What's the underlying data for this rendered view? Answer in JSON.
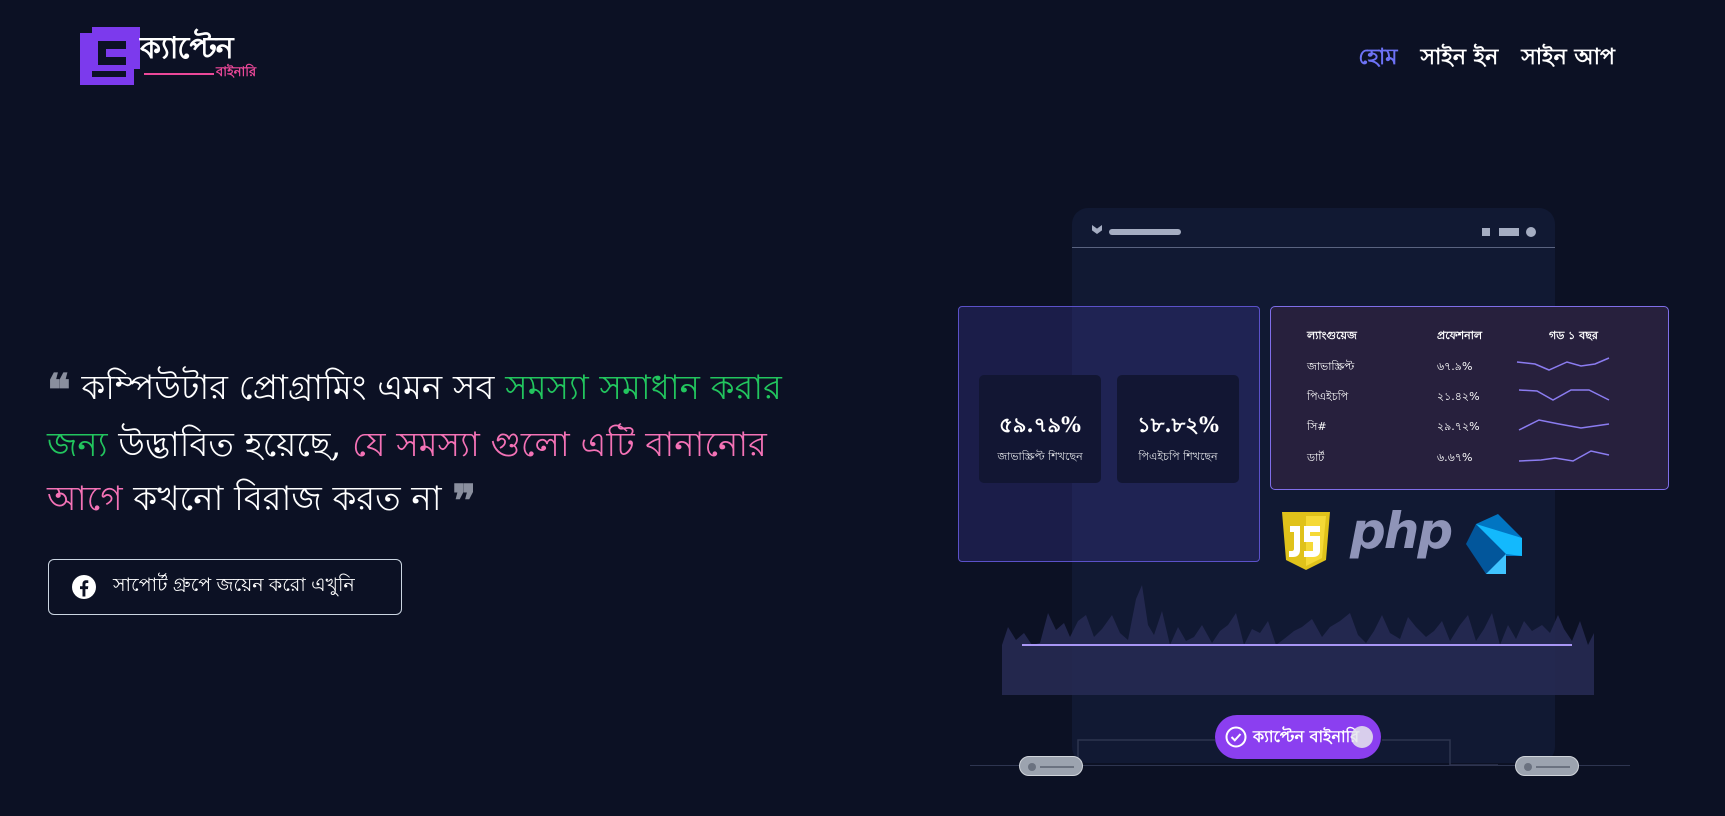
{
  "header": {
    "logo_word": "ক্যাপ্টেন",
    "logo_sub": "বাইনারি",
    "nav": [
      {
        "label": "হোম",
        "active": true
      },
      {
        "label": "সাইন ইন",
        "active": false
      },
      {
        "label": "সাইন আপ",
        "active": false
      }
    ]
  },
  "hero": {
    "quote_white_1": "কম্পিউটার প্রোগ্রামিং এমন সব ",
    "quote_green": "সমস্যা সমাধান করার জন্য",
    "quote_white_2": " উদ্ভাবিত হয়েছে, ",
    "quote_pink": "যে সমস্যা গুলো এটি বানানোর আগে",
    "quote_white_3": " কখনো বিরাজ করত না",
    "cta_label": "সাপোর্ট গ্রুপে জয়েন করো এখুনি"
  },
  "illustration": {
    "stats": [
      {
        "percent": "৫৯.৭৯%",
        "label": "জাভাস্ক্রিপ্ট শিখছেন"
      },
      {
        "percent": "১৮.৮২%",
        "label": "পিএইচপি শিখছেন"
      }
    ],
    "table": {
      "headers": [
        "ল্যাংগুয়েজ",
        "প্রফেশনাল",
        "গড ১ বছর"
      ],
      "rows": [
        {
          "lang": "জাভাস্ক্রিপ্ট",
          "value": "৬৭.৯%"
        },
        {
          "lang": "পিএইচপি",
          "value": "২১.৪২%"
        },
        {
          "lang": "সি#",
          "value": "২৯.৭২%"
        },
        {
          "lang": "ডার্ট",
          "value": "৬.৬৭%"
        }
      ]
    },
    "php_text": "php",
    "badge_label": "ক্যাপ্টেন বাইনারি"
  },
  "colors": {
    "background": "#0c1124",
    "accent_nav": "#6d72f5",
    "green": "#22c55e",
    "pink": "#f472b6",
    "badge": "#8b3ff0"
  }
}
